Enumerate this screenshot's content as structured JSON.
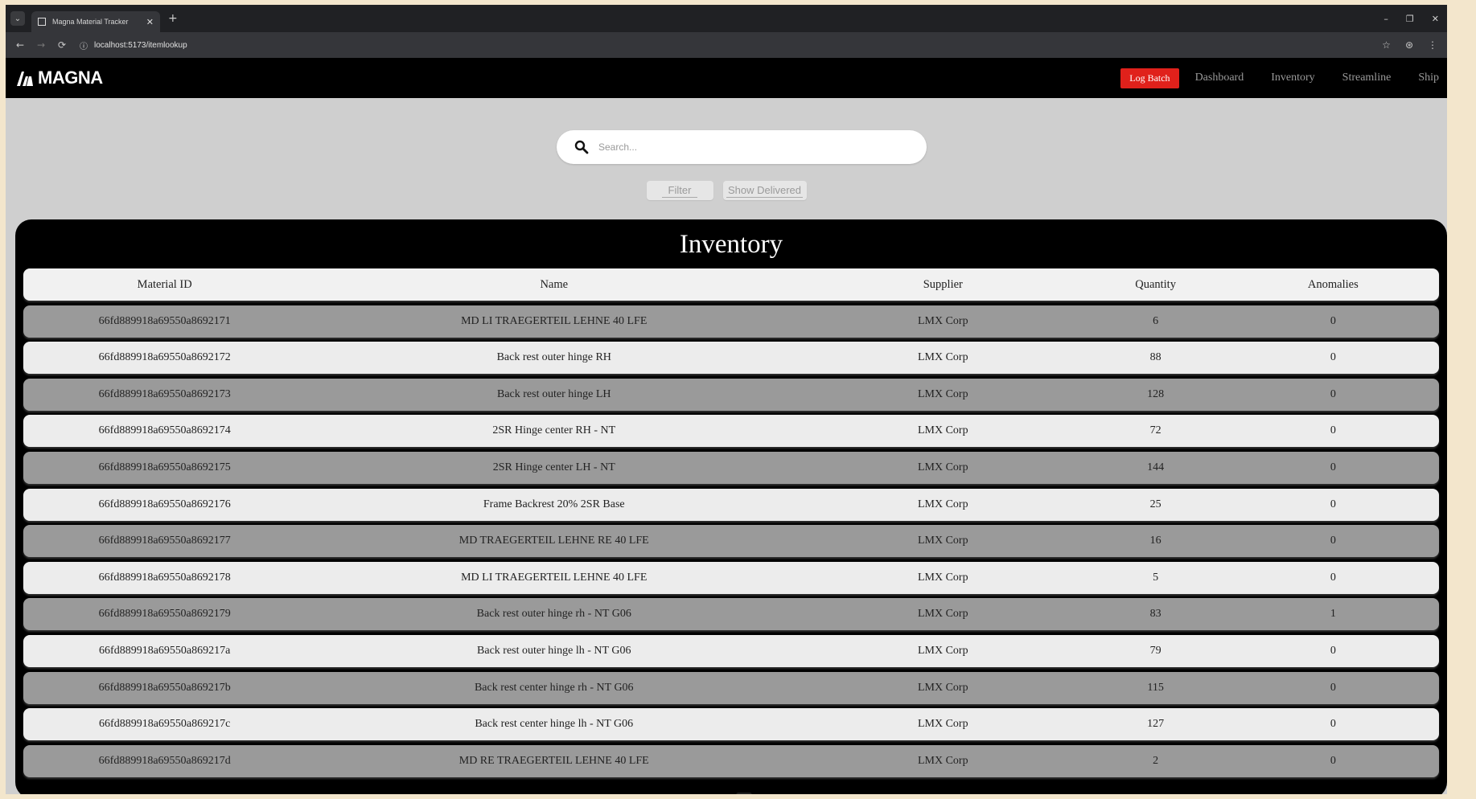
{
  "browser": {
    "tab_title": "Magna Material Tracker",
    "tab_close": "✕",
    "new_tab": "+",
    "url": "localhost:5173/itemlookup",
    "win_min": "–",
    "win_restore": "❐",
    "win_close": "✕"
  },
  "navbar": {
    "logo_text": "MAGNA",
    "log_batch_label": "Log Batch",
    "links": [
      "Dashboard",
      "Inventory",
      "Streamline",
      "Ship"
    ]
  },
  "search": {
    "placeholder": "Search..."
  },
  "buttons": {
    "filter_label": "Filter",
    "show_delivered_label": "Show Delivered"
  },
  "inventory": {
    "title": "Inventory",
    "columns": [
      "Material ID",
      "Name",
      "Supplier",
      "Quantity",
      "Anomalies"
    ],
    "rows": [
      {
        "id": "66fd889918a69550a8692171",
        "name": "MD LI TRAEGERTEIL LEHNE 40 LFE",
        "supplier": "LMX Corp",
        "quantity": "6",
        "anomalies": "0"
      },
      {
        "id": "66fd889918a69550a8692172",
        "name": "Back rest outer hinge RH",
        "supplier": "LMX Corp",
        "quantity": "88",
        "anomalies": "0"
      },
      {
        "id": "66fd889918a69550a8692173",
        "name": "Back rest outer hinge LH",
        "supplier": "LMX Corp",
        "quantity": "128",
        "anomalies": "0"
      },
      {
        "id": "66fd889918a69550a8692174",
        "name": "2SR Hinge center RH - NT",
        "supplier": "LMX Corp",
        "quantity": "72",
        "anomalies": "0"
      },
      {
        "id": "66fd889918a69550a8692175",
        "name": "2SR Hinge center LH - NT",
        "supplier": "LMX Corp",
        "quantity": "144",
        "anomalies": "0"
      },
      {
        "id": "66fd889918a69550a8692176",
        "name": "Frame Backrest 20% 2SR Base",
        "supplier": "LMX Corp",
        "quantity": "25",
        "anomalies": "0"
      },
      {
        "id": "66fd889918a69550a8692177",
        "name": "MD TRAEGERTEIL LEHNE RE 40 LFE",
        "supplier": "LMX Corp",
        "quantity": "16",
        "anomalies": "0"
      },
      {
        "id": "66fd889918a69550a8692178",
        "name": "MD LI TRAEGERTEIL LEHNE 40 LFE",
        "supplier": "LMX Corp",
        "quantity": "5",
        "anomalies": "0"
      },
      {
        "id": "66fd889918a69550a8692179",
        "name": "Back rest outer hinge rh - NT G06",
        "supplier": "LMX Corp",
        "quantity": "83",
        "anomalies": "1"
      },
      {
        "id": "66fd889918a69550a869217a",
        "name": "Back rest outer hinge lh - NT G06",
        "supplier": "LMX Corp",
        "quantity": "79",
        "anomalies": "0"
      },
      {
        "id": "66fd889918a69550a869217b",
        "name": "Back rest center hinge rh - NT G06",
        "supplier": "LMX Corp",
        "quantity": "115",
        "anomalies": "0"
      },
      {
        "id": "66fd889918a69550a869217c",
        "name": "Back rest center hinge lh - NT G06",
        "supplier": "LMX Corp",
        "quantity": "127",
        "anomalies": "0"
      },
      {
        "id": "66fd889918a69550a869217d",
        "name": "MD RE TRAEGERTEIL LEHNE 40 LFE",
        "supplier": "LMX Corp",
        "quantity": "2",
        "anomalies": "0"
      }
    ]
  },
  "colors": {
    "brand_red": "#e0211b",
    "navbar_bg": "#000000",
    "page_bg": "#cfcfcf",
    "row_light": "#ececec",
    "row_dark": "#9a9a9a"
  }
}
